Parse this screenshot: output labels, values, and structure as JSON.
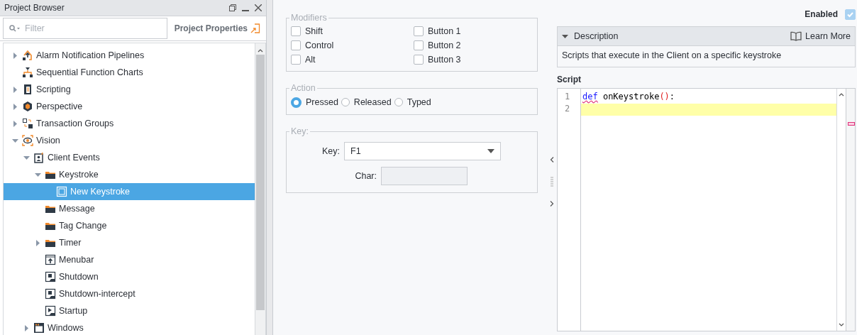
{
  "project_browser": {
    "title": "Project Browser",
    "filter": {
      "placeholder": "Filter"
    },
    "project_properties": "Project Properties",
    "tree": [
      {
        "label": "Alarm Notification Pipelines",
        "kind": "pipeline",
        "expanded": false,
        "selected": false
      },
      {
        "label": "Sequential Function Charts",
        "kind": "sfc",
        "selected": false
      },
      {
        "label": "Scripting",
        "kind": "scripting",
        "expanded": false,
        "selected": false
      },
      {
        "label": "Perspective",
        "kind": "perspective",
        "expanded": false,
        "selected": false
      },
      {
        "label": "Transaction Groups",
        "kind": "transaction",
        "expanded": false,
        "selected": false
      },
      {
        "label": "Vision",
        "kind": "vision",
        "expanded": true,
        "selected": false,
        "children": [
          {
            "label": "Client Events",
            "kind": "events",
            "expanded": true,
            "selected": false,
            "children": [
              {
                "label": "Keystroke",
                "kind": "folder",
                "expanded": true,
                "selected": false,
                "children": [
                  {
                    "label": "New Keystroke",
                    "kind": "keystroke",
                    "selected": true
                  }
                ]
              },
              {
                "label": "Message",
                "kind": "folder",
                "selected": false
              },
              {
                "label": "Tag Change",
                "kind": "folder",
                "selected": false
              },
              {
                "label": "Timer",
                "kind": "folder",
                "expanded": false,
                "selected": false
              },
              {
                "label": "Menubar",
                "kind": "menubar",
                "selected": false
              },
              {
                "label": "Shutdown",
                "kind": "shutdown",
                "selected": false
              },
              {
                "label": "Shutdown-intercept",
                "kind": "shutdown",
                "selected": false
              },
              {
                "label": "Startup",
                "kind": "startup",
                "selected": false
              }
            ]
          },
          {
            "label": "Windows",
            "kind": "windows",
            "expanded": false,
            "selected": false
          }
        ]
      }
    ]
  },
  "modifiers": {
    "legend": "Modifiers",
    "options": [
      {
        "label": "Shift",
        "checked": false
      },
      {
        "label": "Control",
        "checked": false
      },
      {
        "label": "Alt",
        "checked": false
      },
      {
        "label": "Button 1",
        "checked": false
      },
      {
        "label": "Button 2",
        "checked": false
      },
      {
        "label": "Button 3",
        "checked": false
      }
    ]
  },
  "action": {
    "legend": "Action",
    "options": [
      {
        "label": "Pressed",
        "selected": true
      },
      {
        "label": "Released",
        "selected": false
      },
      {
        "label": "Typed",
        "selected": false
      }
    ]
  },
  "key_section": {
    "legend": "Key:",
    "key_label": "Key:",
    "key_value": "F1",
    "char_label": "Char:"
  },
  "enabled": {
    "label": "Enabled",
    "checked": true
  },
  "description": {
    "title": "Description",
    "expanded": true,
    "learn_more": "Learn More",
    "text": "Scripts that execute in the Client on a specific keystroke"
  },
  "script": {
    "label": "Script",
    "lines": [
      {
        "number": "1",
        "current": false,
        "tokens": [
          {
            "kind": "keyword",
            "text": "def",
            "warning": true
          },
          {
            "kind": "plain",
            "text": " onKeystroke",
            "warning": false
          },
          {
            "kind": "paren",
            "text": "()",
            "warning": false
          },
          {
            "kind": "plain",
            "text": ":",
            "warning": false
          }
        ]
      },
      {
        "number": "2",
        "current": true
      }
    ]
  }
}
